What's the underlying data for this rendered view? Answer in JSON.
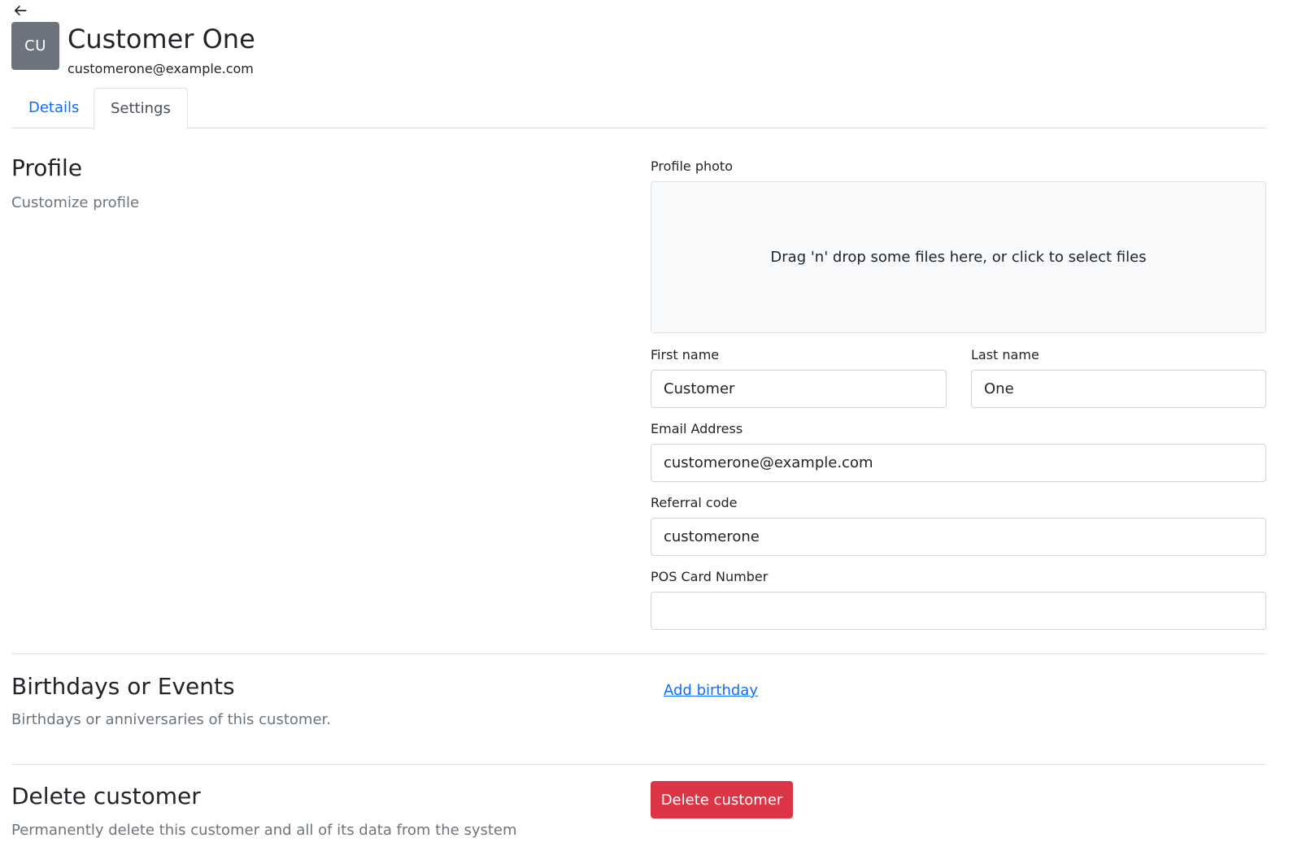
{
  "header": {
    "back_icon": "arrow-left-icon",
    "avatar_initials": "CU",
    "name": "Customer One",
    "email": "customerone@example.com"
  },
  "tabs": [
    {
      "label": "Details",
      "active": false
    },
    {
      "label": "Settings",
      "active": true
    }
  ],
  "profile": {
    "title": "Profile",
    "description": "Customize profile",
    "photo_label": "Profile photo",
    "dropzone_text": "Drag 'n' drop some files here, or click to select files",
    "first_name_label": "First name",
    "first_name_value": "Customer",
    "last_name_label": "Last name",
    "last_name_value": "One",
    "email_label": "Email Address",
    "email_value": "customerone@example.com",
    "referral_label": "Referral code",
    "referral_value": "customerone",
    "pos_label": "POS Card Number",
    "pos_value": ""
  },
  "birthdays": {
    "title": "Birthdays or Events",
    "description": "Birthdays or anniversaries of this customer.",
    "add_link": "Add birthday"
  },
  "delete": {
    "title": "Delete customer",
    "description": "Permanently delete this customer and all of its data from the system",
    "button_label": "Delete customer"
  },
  "colors": {
    "primary": "#0d6efd",
    "danger": "#dc3545",
    "avatar_bg": "#6c757d",
    "muted_text": "#6c757d"
  }
}
